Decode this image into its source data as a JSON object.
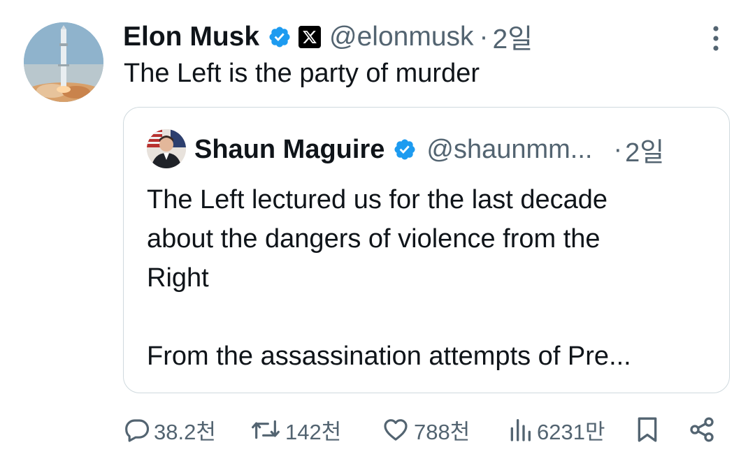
{
  "tweet": {
    "author_name": "Elon Musk",
    "handle": "@elonmusk",
    "separator": "·",
    "time": "2일",
    "text": "The Left is the party of murder"
  },
  "quote": {
    "author_name": "Shaun Maguire",
    "handle": "@shaunmm...",
    "separator": "·",
    "time": "2일",
    "lines": [
      "The Left lectured us for the last decade",
      "about the dangers of violence from the",
      "Right"
    ],
    "line2": "From the assassination attempts of Pre..."
  },
  "actions": {
    "replies": "38.2천",
    "reposts": "142천",
    "likes": "788천",
    "views": "6231만"
  },
  "colors": {
    "verified_blue": "#1d9bf0",
    "secondary_text": "#536471",
    "border": "#cfd9de"
  },
  "icons": [
    "verified-badge-icon",
    "x-logo-icon",
    "more-icon",
    "reply-icon",
    "repost-icon",
    "like-icon",
    "views-icon",
    "bookmark-icon",
    "share-icon"
  ]
}
